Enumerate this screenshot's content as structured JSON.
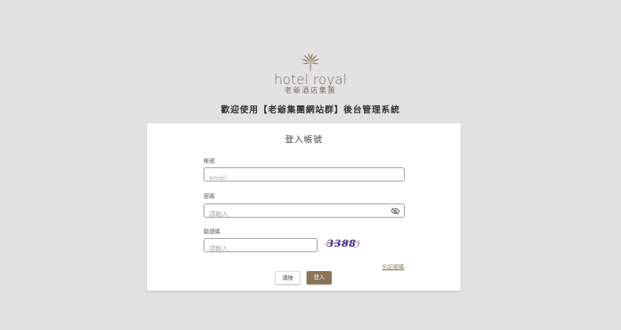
{
  "logo": {
    "brand": "hotel royal",
    "subtitle": "老爺酒店集團"
  },
  "page_title": "歡迎使用【老爺集團網站群】後台管理系統",
  "card": {
    "title": "登入帳號",
    "account": {
      "label": "帳號",
      "placeholder": "email",
      "value": ""
    },
    "password": {
      "label": "密碼",
      "placeholder": "請輸入",
      "value": ""
    },
    "captcha": {
      "label": "驗證碼",
      "placeholder": "請輸入",
      "value": "",
      "image_text": "3388"
    },
    "forgot_label": "忘記密碼",
    "clear_label": "清除",
    "login_label": "登入"
  },
  "colors": {
    "brand": "#8b7355",
    "background": "#e2e2e2"
  }
}
